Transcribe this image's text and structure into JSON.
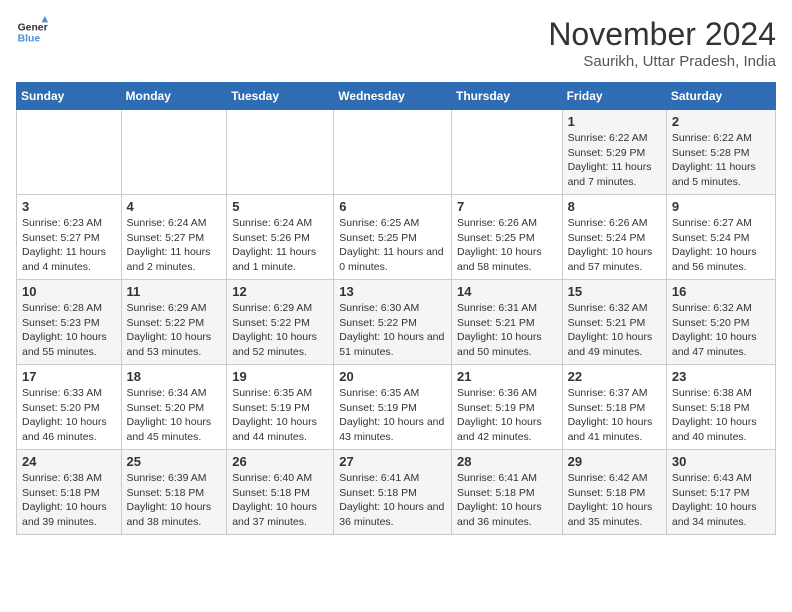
{
  "logo": {
    "line1": "General",
    "line2": "Blue"
  },
  "title": "November 2024",
  "subtitle": "Saurikh, Uttar Pradesh, India",
  "days_of_week": [
    "Sunday",
    "Monday",
    "Tuesday",
    "Wednesday",
    "Thursday",
    "Friday",
    "Saturday"
  ],
  "weeks": [
    [
      {
        "day": "",
        "info": ""
      },
      {
        "day": "",
        "info": ""
      },
      {
        "day": "",
        "info": ""
      },
      {
        "day": "",
        "info": ""
      },
      {
        "day": "",
        "info": ""
      },
      {
        "day": "1",
        "info": "Sunrise: 6:22 AM\nSunset: 5:29 PM\nDaylight: 11 hours and 7 minutes."
      },
      {
        "day": "2",
        "info": "Sunrise: 6:22 AM\nSunset: 5:28 PM\nDaylight: 11 hours and 5 minutes."
      }
    ],
    [
      {
        "day": "3",
        "info": "Sunrise: 6:23 AM\nSunset: 5:27 PM\nDaylight: 11 hours and 4 minutes."
      },
      {
        "day": "4",
        "info": "Sunrise: 6:24 AM\nSunset: 5:27 PM\nDaylight: 11 hours and 2 minutes."
      },
      {
        "day": "5",
        "info": "Sunrise: 6:24 AM\nSunset: 5:26 PM\nDaylight: 11 hours and 1 minute."
      },
      {
        "day": "6",
        "info": "Sunrise: 6:25 AM\nSunset: 5:25 PM\nDaylight: 11 hours and 0 minutes."
      },
      {
        "day": "7",
        "info": "Sunrise: 6:26 AM\nSunset: 5:25 PM\nDaylight: 10 hours and 58 minutes."
      },
      {
        "day": "8",
        "info": "Sunrise: 6:26 AM\nSunset: 5:24 PM\nDaylight: 10 hours and 57 minutes."
      },
      {
        "day": "9",
        "info": "Sunrise: 6:27 AM\nSunset: 5:24 PM\nDaylight: 10 hours and 56 minutes."
      }
    ],
    [
      {
        "day": "10",
        "info": "Sunrise: 6:28 AM\nSunset: 5:23 PM\nDaylight: 10 hours and 55 minutes."
      },
      {
        "day": "11",
        "info": "Sunrise: 6:29 AM\nSunset: 5:22 PM\nDaylight: 10 hours and 53 minutes."
      },
      {
        "day": "12",
        "info": "Sunrise: 6:29 AM\nSunset: 5:22 PM\nDaylight: 10 hours and 52 minutes."
      },
      {
        "day": "13",
        "info": "Sunrise: 6:30 AM\nSunset: 5:22 PM\nDaylight: 10 hours and 51 minutes."
      },
      {
        "day": "14",
        "info": "Sunrise: 6:31 AM\nSunset: 5:21 PM\nDaylight: 10 hours and 50 minutes."
      },
      {
        "day": "15",
        "info": "Sunrise: 6:32 AM\nSunset: 5:21 PM\nDaylight: 10 hours and 49 minutes."
      },
      {
        "day": "16",
        "info": "Sunrise: 6:32 AM\nSunset: 5:20 PM\nDaylight: 10 hours and 47 minutes."
      }
    ],
    [
      {
        "day": "17",
        "info": "Sunrise: 6:33 AM\nSunset: 5:20 PM\nDaylight: 10 hours and 46 minutes."
      },
      {
        "day": "18",
        "info": "Sunrise: 6:34 AM\nSunset: 5:20 PM\nDaylight: 10 hours and 45 minutes."
      },
      {
        "day": "19",
        "info": "Sunrise: 6:35 AM\nSunset: 5:19 PM\nDaylight: 10 hours and 44 minutes."
      },
      {
        "day": "20",
        "info": "Sunrise: 6:35 AM\nSunset: 5:19 PM\nDaylight: 10 hours and 43 minutes."
      },
      {
        "day": "21",
        "info": "Sunrise: 6:36 AM\nSunset: 5:19 PM\nDaylight: 10 hours and 42 minutes."
      },
      {
        "day": "22",
        "info": "Sunrise: 6:37 AM\nSunset: 5:18 PM\nDaylight: 10 hours and 41 minutes."
      },
      {
        "day": "23",
        "info": "Sunrise: 6:38 AM\nSunset: 5:18 PM\nDaylight: 10 hours and 40 minutes."
      }
    ],
    [
      {
        "day": "24",
        "info": "Sunrise: 6:38 AM\nSunset: 5:18 PM\nDaylight: 10 hours and 39 minutes."
      },
      {
        "day": "25",
        "info": "Sunrise: 6:39 AM\nSunset: 5:18 PM\nDaylight: 10 hours and 38 minutes."
      },
      {
        "day": "26",
        "info": "Sunrise: 6:40 AM\nSunset: 5:18 PM\nDaylight: 10 hours and 37 minutes."
      },
      {
        "day": "27",
        "info": "Sunrise: 6:41 AM\nSunset: 5:18 PM\nDaylight: 10 hours and 36 minutes."
      },
      {
        "day": "28",
        "info": "Sunrise: 6:41 AM\nSunset: 5:18 PM\nDaylight: 10 hours and 36 minutes."
      },
      {
        "day": "29",
        "info": "Sunrise: 6:42 AM\nSunset: 5:18 PM\nDaylight: 10 hours and 35 minutes."
      },
      {
        "day": "30",
        "info": "Sunrise: 6:43 AM\nSunset: 5:17 PM\nDaylight: 10 hours and 34 minutes."
      }
    ]
  ]
}
